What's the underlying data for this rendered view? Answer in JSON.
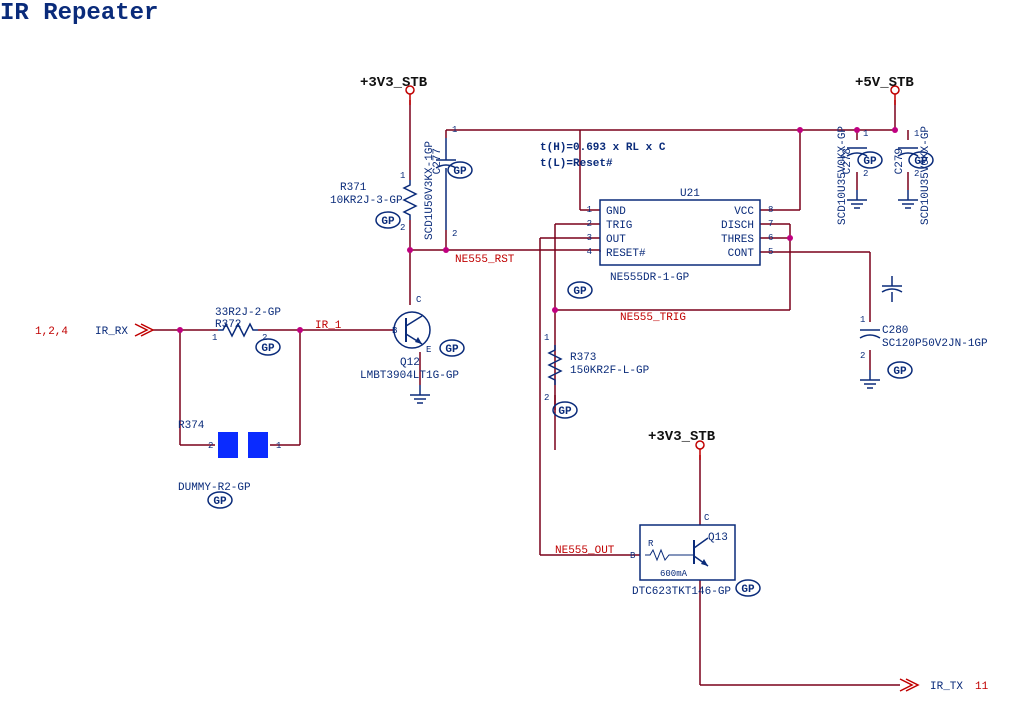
{
  "title": "IR Repeater",
  "powers": {
    "p3v3_1": "+3V3_STB",
    "p5v": "+5V_STB",
    "p3v3_2": "+3V3_STB"
  },
  "nets": {
    "ir_rx": "IR_RX",
    "ir_rx_refs": "1,2,4",
    "ir_1": "IR_1",
    "ne555_rst": "NE555_RST",
    "ne555_trig": "NE555_TRIG",
    "ne555_out": "NE555_OUT",
    "ir_tx": "IR_TX",
    "ir_tx_ref": "11"
  },
  "formula": {
    "l1": "t(H)=0.693 x RL x C",
    "l2": "t(L)=Reset#"
  },
  "u21": {
    "ref": "U21",
    "part": "NE555DR-1-GP",
    "pins_left": {
      "1": "GND",
      "2": "TRIG",
      "3": "OUT",
      "4": "RESET#"
    },
    "pins_right": {
      "8": "VCC",
      "7": "DISCH",
      "6": "THRES",
      "5": "CONT"
    }
  },
  "components": {
    "r371": {
      "ref": "R371",
      "val": "10KR2J-3-GP"
    },
    "r372": {
      "ref": "R372",
      "val": "33R2J-2-GP"
    },
    "r373": {
      "ref": "R373",
      "val": "150KR2F-L-GP"
    },
    "r374": {
      "ref": "R374",
      "val": "DUMMY-R2-GP"
    },
    "c277": {
      "ref": "C277",
      "val": "SCD1U50V3KX-1GP"
    },
    "c278": {
      "ref": "C278",
      "val": "SCD10U35V0KX-GP"
    },
    "c279": {
      "ref": "C279",
      "val": "SCD10U35V0KX-GP"
    },
    "c280": {
      "ref": "C280",
      "val": "SC120P50V2JN-1GP"
    },
    "q12": {
      "ref": "Q12",
      "val": "LMBT3904LT1G-GP"
    },
    "q13": {
      "ref": "Q13",
      "val": "DTC623TKT146-GP",
      "note": "600mA",
      "rlabel": "R"
    }
  },
  "pin_labels": {
    "one": "1",
    "two": "2",
    "b": "B",
    "c": "C",
    "e": "E"
  }
}
